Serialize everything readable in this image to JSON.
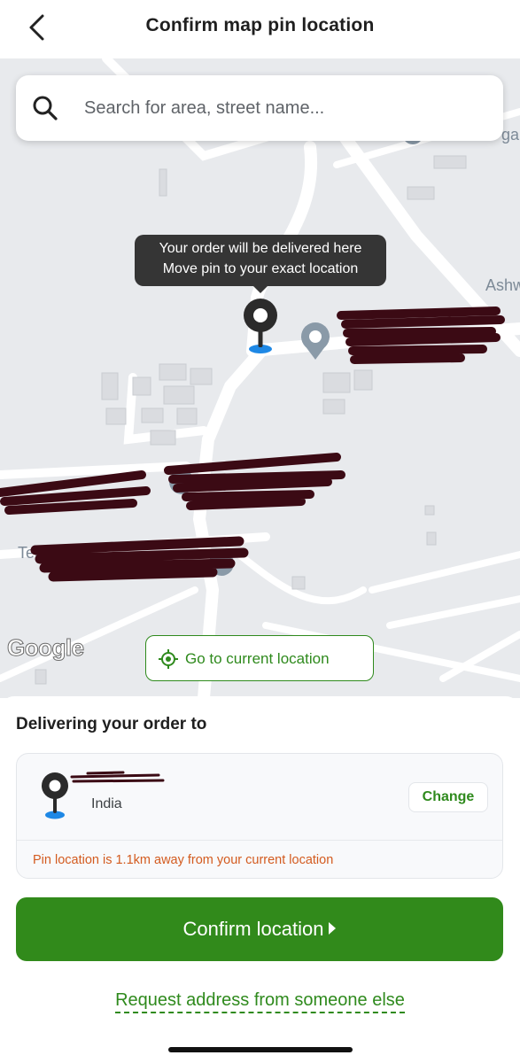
{
  "header": {
    "title": "Confirm map pin location",
    "back_icon": "chevron-left-icon"
  },
  "search": {
    "placeholder": "Search for area, street name...",
    "icon": "search-icon"
  },
  "map": {
    "tooltip": {
      "line1": "Your order will be delivered here",
      "line2": "Move pin to your exact location"
    },
    "labels": {
      "ashw": "Ashw",
      "terr": "Terr",
      "ga": "ga"
    },
    "google_logo": "Google",
    "go_current_label": "Go to current location"
  },
  "sheet": {
    "title": "Delivering your order to",
    "address_country": "India",
    "change_label": "Change",
    "warning": "Pin location is 1.1km away from your current location",
    "confirm_label": "Confirm location",
    "request_label": "Request address from someone else"
  },
  "colors": {
    "accent": "#2f8a1d",
    "confirm_bg": "#318a1b",
    "warning": "#d35b1f",
    "tooltip_bg": "#353535",
    "map_bg": "#e8eaed",
    "pin_blue": "#1e88e5"
  }
}
